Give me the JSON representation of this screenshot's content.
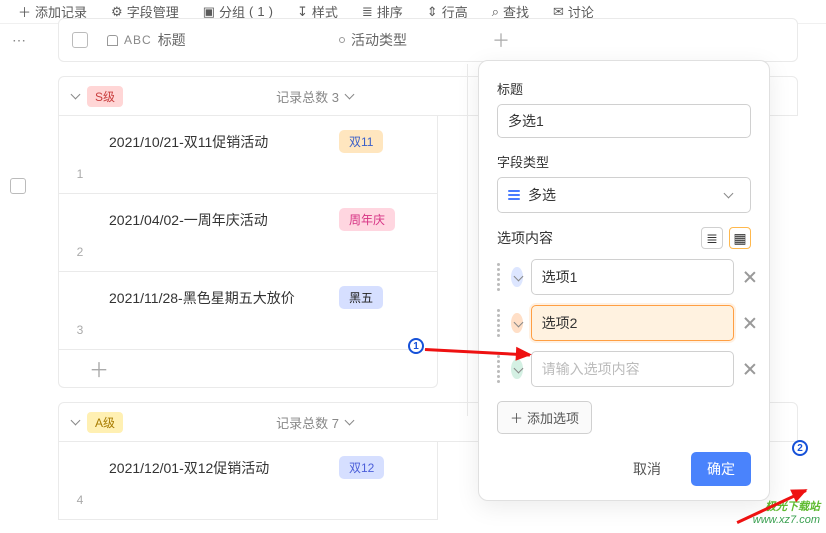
{
  "toolbar": {
    "add_record": "添加记录",
    "field_mgmt": "字段管理",
    "group": "分组",
    "group_count": "1",
    "style": "样式",
    "sort": "排序",
    "row_height": "行高",
    "view": "查找",
    "comment": "讨论"
  },
  "columns": {
    "title_small": "ABC",
    "title": "标题",
    "type": "活动类型"
  },
  "groups": [
    {
      "badge": "S级",
      "badge_class": "badge-s",
      "count_label": "记录总数 3",
      "rows": [
        {
          "idx": "1",
          "title": "2021/10/21-双11促销活动",
          "tag": "双11",
          "tag_class": "tag-d11"
        },
        {
          "idx": "2",
          "title": "2021/04/02-一周年庆活动",
          "tag": "周年庆",
          "tag_class": "tag-anni"
        },
        {
          "idx": "3",
          "title": "2021/11/28-黑色星期五大放价",
          "tag": "黑五",
          "tag_class": "tag-black"
        }
      ]
    },
    {
      "badge": "A级",
      "badge_class": "badge-a",
      "count_label": "记录总数 7",
      "rows": [
        {
          "idx": "4",
          "title": "2021/12/01-双12促销活动",
          "tag": "双12",
          "tag_class": "tag-d12"
        }
      ]
    }
  ],
  "panel": {
    "title_label": "标题",
    "title_value": "多选1",
    "field_type_label": "字段类型",
    "field_type_value": "多选",
    "options_label": "选项内容",
    "options": [
      {
        "value": "选项1",
        "color": "blue",
        "hl": false
      },
      {
        "value": "选项2",
        "color": "orange",
        "hl": true
      },
      {
        "value": "",
        "color": "green",
        "hl": false
      }
    ],
    "option_placeholder": "请输入选项内容",
    "add_option": "添加选项",
    "cancel": "取消",
    "confirm": "确定"
  },
  "annotations": {
    "n1": "1",
    "n2": "2"
  },
  "watermark": {
    "brand": "极光下载站",
    "url": "www.xz7.com"
  }
}
